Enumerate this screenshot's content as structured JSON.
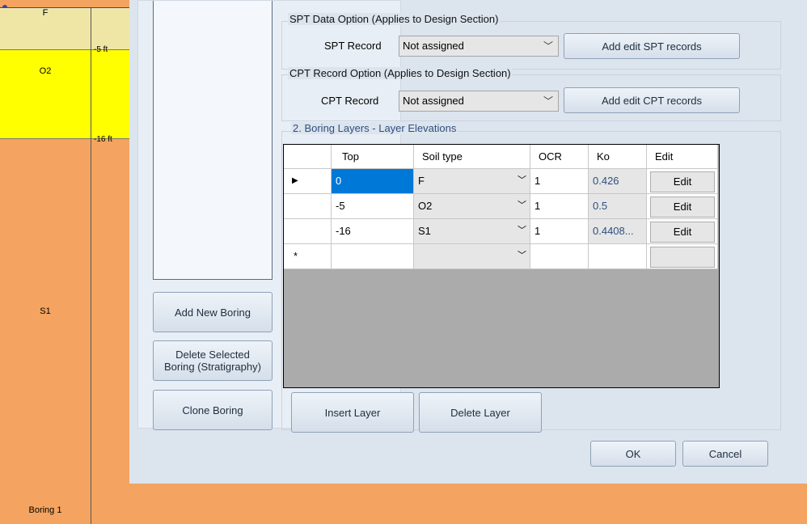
{
  "strata": {
    "layers": [
      {
        "name": "F",
        "elevation": ""
      },
      {
        "name": "O2",
        "elevation": "-5 ft"
      },
      {
        "name": "S1",
        "elevation": "-16 ft"
      }
    ],
    "boring_name": "Boring 1",
    "colors": {
      "F": "#EFE6A6",
      "O2": "#FFFF00",
      "S1": "#F4A460"
    }
  },
  "buttons": {
    "add_new_boring": "Add New Boring",
    "delete_selected_line1": "Delete Selected",
    "delete_selected_line2": "Boring (Stratigraphy)",
    "clone_boring": "Clone Boring",
    "add_edit_spt": "Add edit SPT records",
    "add_edit_cpt": "Add edit CPT records",
    "insert_layer": "Insert Layer",
    "delete_layer": "Delete Layer",
    "ok": "OK",
    "cancel": "Cancel"
  },
  "spt": {
    "group_title": "SPT Data Option (Applies to Design Section)",
    "label": "SPT Record",
    "value": "Not assigned"
  },
  "cpt": {
    "group_title": "CPT Record Option (Applies to Design Section)",
    "label": "CPT Record",
    "value": "Not assigned"
  },
  "layers_section": {
    "title": "2. Boring Layers - Layer Elevations",
    "columns": [
      "Top",
      "Soil type",
      "OCR",
      "Ko",
      "Edit"
    ],
    "rows": [
      {
        "top": "0",
        "soil": "F",
        "ocr": "1",
        "ko": "0.426",
        "edit": "Edit"
      },
      {
        "top": "-5",
        "soil": "O2",
        "ocr": "1",
        "ko": "0.5",
        "edit": "Edit"
      },
      {
        "top": "-16",
        "soil": "S1",
        "ocr": "1",
        "ko": "0.4408...",
        "edit": "Edit"
      }
    ],
    "new_row_marker": "*",
    "current_row_marker": "▶",
    "chevron": "﹀"
  }
}
